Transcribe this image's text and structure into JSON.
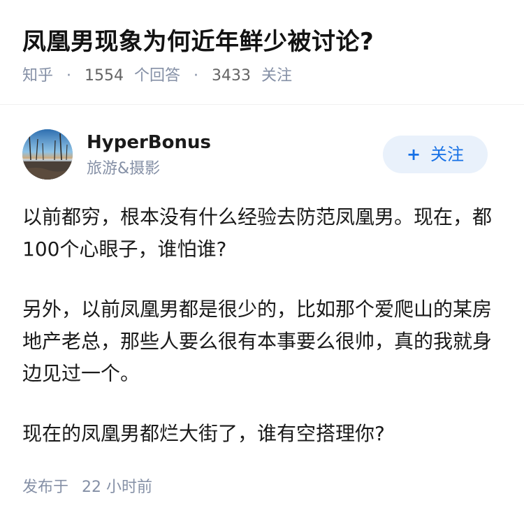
{
  "question": {
    "title": "凤凰男现象为何近年鲜少被讨论?",
    "source": "知乎",
    "separator": "·",
    "answers_count": "1554",
    "answers_label": "个回答",
    "followers_count": "3433",
    "followers_label": "关注"
  },
  "author": {
    "name": "HyperBonus",
    "bio": "旅游&摄影",
    "avatar_icon": "avatar-landscape-photo",
    "follow_icon": "plus-icon",
    "follow_plus": "+",
    "follow_label": "关注"
  },
  "answer": {
    "paragraphs": [
      "以前都穷，根本没有什么经验去防范凤凰男。现在，都100个心眼子，谁怕谁?",
      "另外，以前凤凰男都是很少的，比如那个爱爬山的某房地产老总，那些人要么很有本事要么很帅，真的我就身边见过一个。",
      "现在的凤凰男都烂大街了，谁有空搭理你?"
    ],
    "published_label": "发布于",
    "published_time": "22 小时前"
  },
  "colors": {
    "accent": "#1771e6",
    "follow_bg": "#e9f1fb",
    "meta_gray": "#8590a6",
    "title": "#121212"
  }
}
